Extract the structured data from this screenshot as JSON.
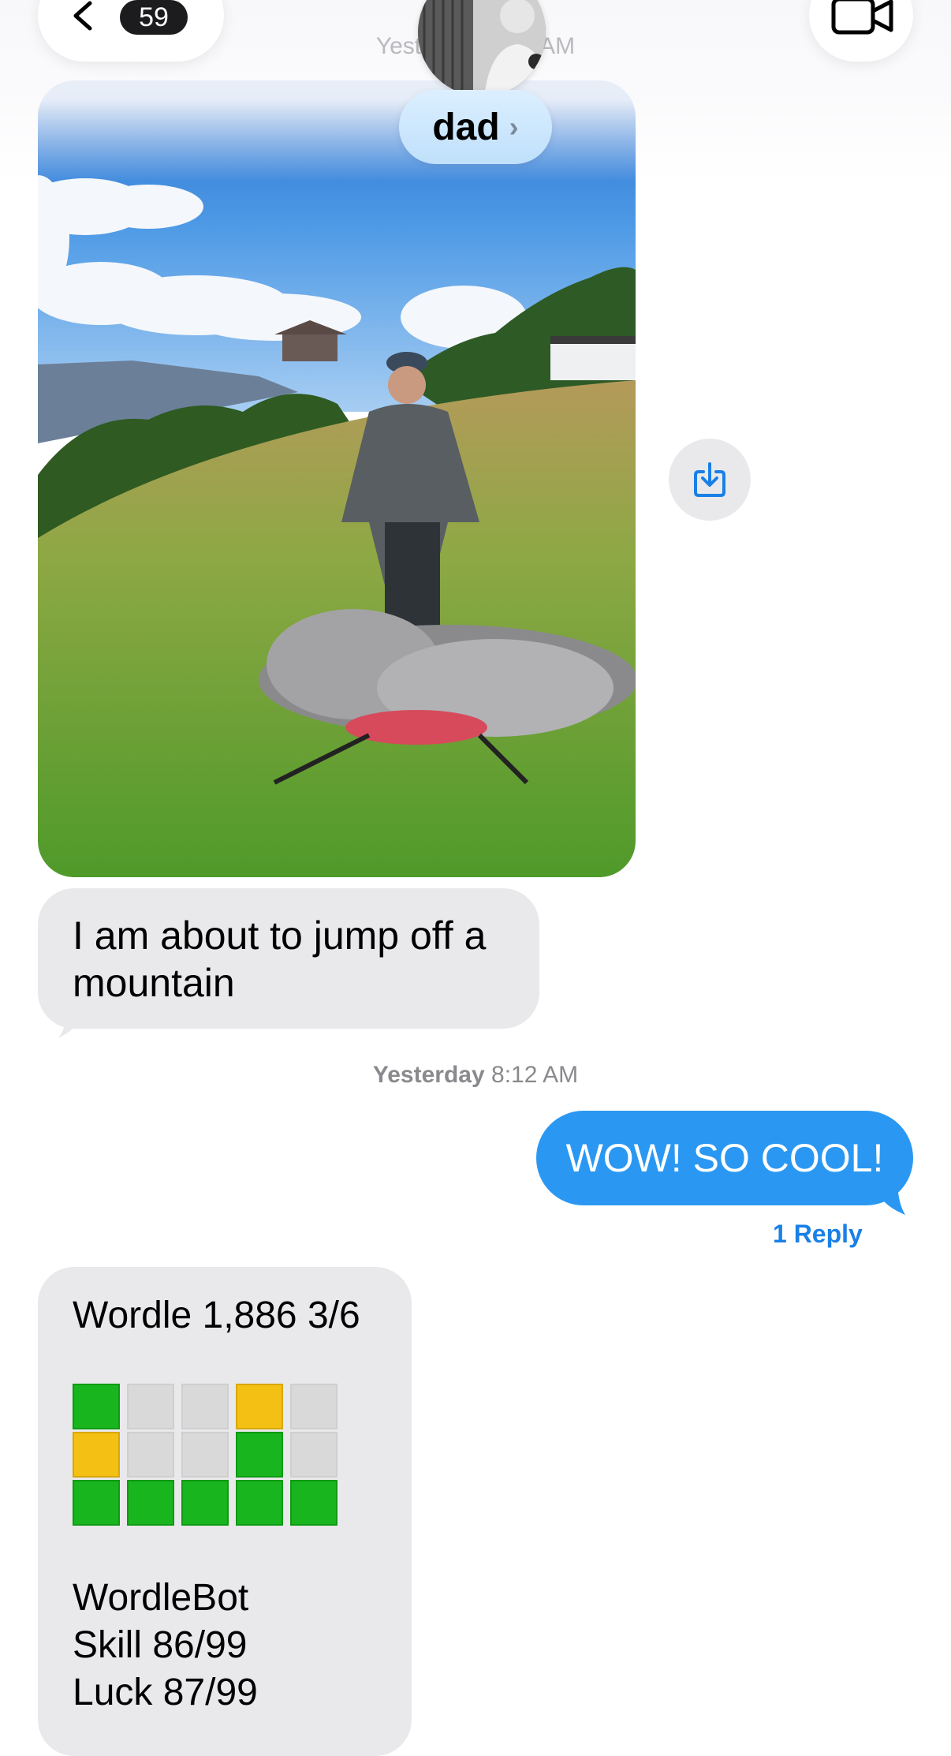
{
  "header": {
    "back_count": "59",
    "contact_name": "dad",
    "timestamp_visible": "Yest",
    "timestamp_visible_end": "AM"
  },
  "messages": {
    "incoming_text": "I am about to jump off a mountain",
    "timestamp_day": "Yesterday",
    "timestamp_time": "8:12 AM",
    "outgoing_text": "WOW! SO COOL!",
    "reply_count": "1 Reply"
  },
  "wordle": {
    "title": "Wordle 1,886 3/6",
    "rows": [
      [
        "green",
        "gray",
        "gray",
        "yellow",
        "gray"
      ],
      [
        "yellow",
        "gray",
        "gray",
        "green",
        "gray"
      ],
      [
        "green",
        "green",
        "green",
        "green",
        "green"
      ]
    ],
    "bot_line1": "WordleBot",
    "bot_line2": "Skill 86/99",
    "bot_line3": "Luck 87/99"
  },
  "colors": {
    "outgoing_bubble": "#2a98f2",
    "incoming_bubble": "#e9e9eb",
    "link": "#1a80e6"
  },
  "icons": {
    "back": "chevron-left-icon",
    "video": "video-camera-icon",
    "save": "save-download-icon"
  }
}
